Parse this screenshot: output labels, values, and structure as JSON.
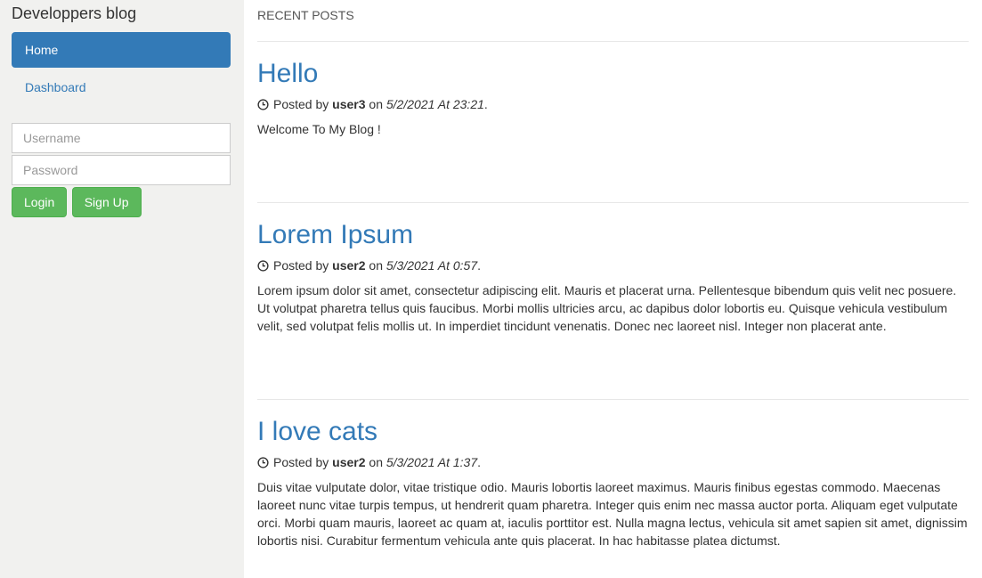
{
  "sidebar": {
    "brand": "Developpers blog",
    "nav": [
      {
        "label": "Home"
      },
      {
        "label": "Dashboard"
      }
    ],
    "login": {
      "username_placeholder": "Username",
      "password_placeholder": "Password",
      "login_label": "Login",
      "signup_label": "Sign Up"
    }
  },
  "main": {
    "section_title": "RECENT POSTS",
    "posts": [
      {
        "title": "Hello",
        "posted_by": "Posted by",
        "author": "user3",
        "on": "on",
        "date": "5/2/2021 At 23:21",
        "period": ".",
        "body": "Welcome To My Blog !"
      },
      {
        "title": "Lorem Ipsum",
        "posted_by": "Posted by",
        "author": "user2",
        "on": "on",
        "date": "5/3/2021 At 0:57",
        "period": ".",
        "body": "Lorem ipsum dolor sit amet, consectetur adipiscing elit. Mauris et placerat urna. Pellentesque bibendum quis velit nec posuere. Ut volutpat pharetra tellus quis faucibus. Morbi mollis ultricies arcu, ac dapibus dolor lobortis eu. Quisque vehicula vestibulum velit, sed volutpat felis mollis ut. In imperdiet tincidunt venenatis. Donec nec laoreet nisl. Integer non placerat ante."
      },
      {
        "title": "I love cats",
        "posted_by": "Posted by",
        "author": "user2",
        "on": "on",
        "date": "5/3/2021 At 1:37",
        "period": ".",
        "body": "Duis vitae vulputate dolor, vitae tristique odio. Mauris lobortis laoreet maximus. Mauris finibus egestas commodo. Maecenas laoreet nunc vitae turpis tempus, ut hendrerit quam pharetra. Integer quis enim nec massa auctor porta. Aliquam eget vulputate orci. Morbi quam mauris, laoreet ac quam at, iaculis porttitor est. Nulla magna lectus, vehicula sit amet sapien sit amet, dignissim lobortis nisi. Curabitur fermentum vehicula ante quis placerat. In hac habitasse platea dictumst."
      }
    ]
  },
  "colors": {
    "sidebar_bg": "#f1f1ef",
    "primary": "#337ab7",
    "success": "#5cb85c"
  },
  "icons": {
    "post_meta": "clock-icon"
  }
}
